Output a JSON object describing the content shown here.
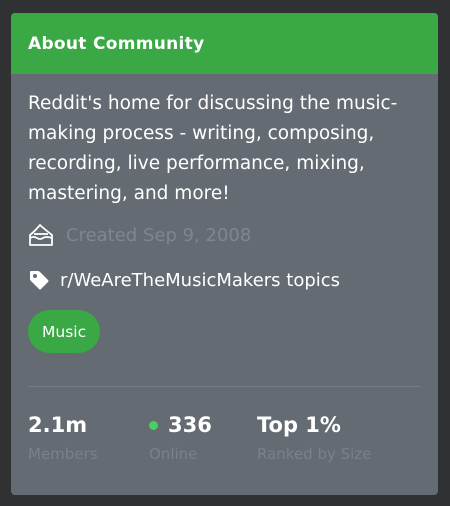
{
  "header": {
    "title": "About Community",
    "color": "#39a845"
  },
  "description": "Reddit's home for discussing the music-making process - writing, composing, recording, live performance, mixing, mastering, and more!",
  "created": {
    "icon": "cake-icon",
    "text": "Created Sep 9, 2008"
  },
  "topics": {
    "icon": "tag-icon",
    "text": "r/WeAreTheMusicMakers topics"
  },
  "topic_pill": {
    "label": "Music"
  },
  "stats": {
    "members": {
      "value": "2.1m",
      "label": "Members"
    },
    "online": {
      "value": "336",
      "label": "Online",
      "dot_color": "#46d160"
    },
    "rank": {
      "value": "Top 1%",
      "label": "Ranked by Size"
    }
  }
}
